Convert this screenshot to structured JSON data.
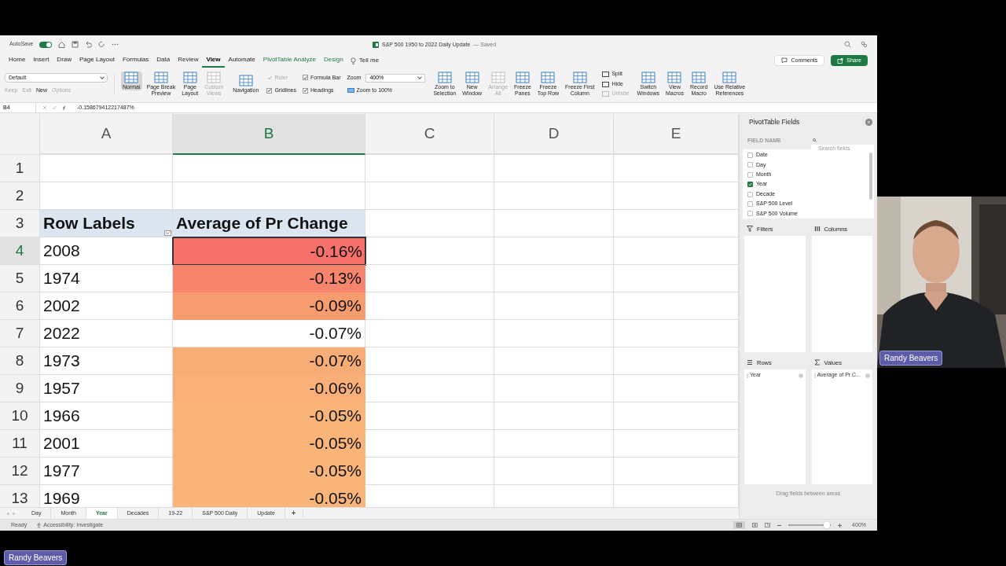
{
  "title_bar": {
    "autosave_label": "AutoSave",
    "autosave_on": true,
    "title": "S&P 500 1950 to 2022 Daily Update",
    "save_state": "— Saved"
  },
  "menu_tabs": [
    {
      "label": "Home",
      "selected": false,
      "contextual": false
    },
    {
      "label": "Insert",
      "selected": false,
      "contextual": false
    },
    {
      "label": "Draw",
      "selected": false,
      "contextual": false
    },
    {
      "label": "Page Layout",
      "selected": false,
      "contextual": false
    },
    {
      "label": "Formulas",
      "selected": false,
      "contextual": false
    },
    {
      "label": "Data",
      "selected": false,
      "contextual": false
    },
    {
      "label": "Review",
      "selected": false,
      "contextual": false
    },
    {
      "label": "View",
      "selected": true,
      "contextual": false
    },
    {
      "label": "Automate",
      "selected": false,
      "contextual": false
    },
    {
      "label": "PivotTable Analyze",
      "selected": false,
      "contextual": true
    },
    {
      "label": "Design",
      "selected": false,
      "contextual": true
    }
  ],
  "tell_me": "Tell me",
  "comments_button": "Comments",
  "share_button": "Share",
  "ribbon": [
    {
      "kind": "style",
      "value": "Default",
      "buttons": [
        {
          "label": "Keep",
          "disabled": true
        },
        {
          "label": "Exit",
          "disabled": true
        },
        {
          "label": "New",
          "disabled": false
        },
        {
          "label": "Options",
          "disabled": true
        }
      ]
    },
    {
      "kind": "large",
      "buttons": [
        {
          "label": "Normal",
          "selected": true,
          "disabled": false
        },
        {
          "label": "Page Break\nPreview",
          "selected": false,
          "disabled": false
        },
        {
          "label": "Page\nLayout",
          "selected": false,
          "disabled": false
        },
        {
          "label": "Custom\nViews",
          "selected": false,
          "disabled": true
        }
      ]
    },
    {
      "kind": "large",
      "buttons": [
        {
          "label": "Navigation",
          "selected": false,
          "disabled": false
        }
      ]
    },
    {
      "kind": "checks",
      "items": [
        {
          "label": "Ruler",
          "checked": true,
          "disabled": true
        },
        {
          "label": "Gridlines",
          "checked": true,
          "disabled": false
        },
        {
          "label": "Formula Bar",
          "checked": true,
          "disabled": false
        },
        {
          "label": "Headings",
          "checked": true,
          "disabled": false
        }
      ]
    },
    {
      "kind": "zoom",
      "label": "Zoom",
      "value": "400%",
      "button": "Zoom to 100%"
    },
    {
      "kind": "large",
      "buttons": [
        {
          "label": "Zoom to\nSelection",
          "selected": false,
          "disabled": false
        },
        {
          "label": "New\nWindow",
          "selected": false,
          "disabled": false
        },
        {
          "label": "Arrange\nAll",
          "selected": false,
          "disabled": true
        },
        {
          "label": "Freeze\nPanes",
          "selected": false,
          "disabled": false
        },
        {
          "label": "Freeze\nTop Row",
          "selected": false,
          "disabled": false
        },
        {
          "label": "Freeze First\nColumn",
          "selected": false,
          "disabled": false
        }
      ]
    },
    {
      "kind": "stack",
      "items": [
        {
          "label": "Split",
          "disabled": false
        },
        {
          "label": "Hide",
          "disabled": false
        },
        {
          "label": "Unhide",
          "disabled": true
        }
      ]
    },
    {
      "kind": "large",
      "buttons": [
        {
          "label": "Switch\nWindows",
          "selected": false,
          "disabled": false
        },
        {
          "label": "View\nMacros",
          "selected": false,
          "disabled": false
        },
        {
          "label": "Record\nMacro",
          "selected": false,
          "disabled": false
        },
        {
          "label": "Use Relative\nReferences",
          "selected": false,
          "disabled": false
        }
      ]
    }
  ],
  "formula_bar": {
    "name_box": "B4",
    "formula": "-0.158679412217487%"
  },
  "sheet": {
    "columns": [
      {
        "label": "A",
        "selected": false
      },
      {
        "label": "B",
        "selected": true
      },
      {
        "label": "C",
        "selected": false
      },
      {
        "label": "D",
        "selected": false
      },
      {
        "label": "E",
        "selected": false
      }
    ],
    "rows": [
      {
        "number": "1",
        "kind": "empty",
        "selected": false
      },
      {
        "number": "2",
        "kind": "empty",
        "selected": false
      },
      {
        "number": "3",
        "kind": "header",
        "selected": false,
        "label": "Row Labels",
        "value": "Average of Pr Change"
      },
      {
        "number": "4",
        "kind": "data",
        "selected": true,
        "label": "2008",
        "value": "-0.16%",
        "color": "#f6716b"
      },
      {
        "number": "5",
        "kind": "data",
        "selected": false,
        "label": "1974",
        "value": "-0.13%",
        "color": "#f7846c"
      },
      {
        "number": "6",
        "kind": "data",
        "selected": false,
        "label": "2002",
        "value": "-0.09%",
        "color": "#f89c6f"
      },
      {
        "number": "7",
        "kind": "data",
        "selected": false,
        "label": "2022",
        "value": "-0.07%"
      },
      {
        "number": "8",
        "kind": "data",
        "selected": false,
        "label": "1973",
        "value": "-0.07%",
        "color": "#f8ac76"
      },
      {
        "number": "9",
        "kind": "data",
        "selected": false,
        "label": "1957",
        "value": "-0.06%",
        "color": "#f8b078"
      },
      {
        "number": "10",
        "kind": "data",
        "selected": false,
        "label": "1966",
        "value": "-0.05%",
        "color": "#f9b47a"
      },
      {
        "number": "11",
        "kind": "data",
        "selected": false,
        "label": "2001",
        "value": "-0.05%",
        "color": "#f9b47a"
      },
      {
        "number": "12",
        "kind": "data",
        "selected": false,
        "label": "1977",
        "value": "-0.05%",
        "color": "#f9b47a"
      },
      {
        "number": "13",
        "kind": "data",
        "selected": false,
        "label": "1969",
        "value": "-0.05%",
        "color": "#f9b47a"
      }
    ]
  },
  "pivot_pane": {
    "title": "PivotTable Fields",
    "field_name_label": "FIELD NAME",
    "search_placeholder": "Search fields",
    "fields": [
      {
        "label": "Date",
        "checked": false
      },
      {
        "label": "Day",
        "checked": false
      },
      {
        "label": "Month",
        "checked": false
      },
      {
        "label": "Year",
        "checked": true
      },
      {
        "label": "Decade",
        "checked": false
      },
      {
        "label": "S&P 500 Level",
        "checked": false
      },
      {
        "label": "S&P 500 Volume",
        "checked": false
      }
    ],
    "areas": [
      {
        "kind": "filters",
        "label": "Filters"
      },
      {
        "kind": "columns",
        "label": "Columns"
      },
      {
        "kind": "rows",
        "label": "Rows",
        "items": [
          "Year"
        ]
      },
      {
        "kind": "values",
        "label": "Values",
        "items": [
          "Average of Pr C..."
        ]
      }
    ],
    "hint": "Drag fields between areas"
  },
  "sheet_tabs": [
    {
      "label": "Day",
      "selected": false
    },
    {
      "label": "Month",
      "selected": false
    },
    {
      "label": "Year",
      "selected": true
    },
    {
      "label": "Decades",
      "selected": false
    },
    {
      "label": "19-22",
      "selected": false
    },
    {
      "label": "S&P 500 Daily",
      "selected": false
    },
    {
      "label": "Update",
      "selected": false
    }
  ],
  "add_sheet": "+",
  "status_bar": {
    "ready": "Ready",
    "accessibility": "Accessibility: Investigate",
    "level": 0.9,
    "zoom": "400%"
  },
  "webcam": {
    "kind": "picture",
    "name_tag": "Randy Beavers"
  },
  "presenter_tag": "Randy Beavers"
}
